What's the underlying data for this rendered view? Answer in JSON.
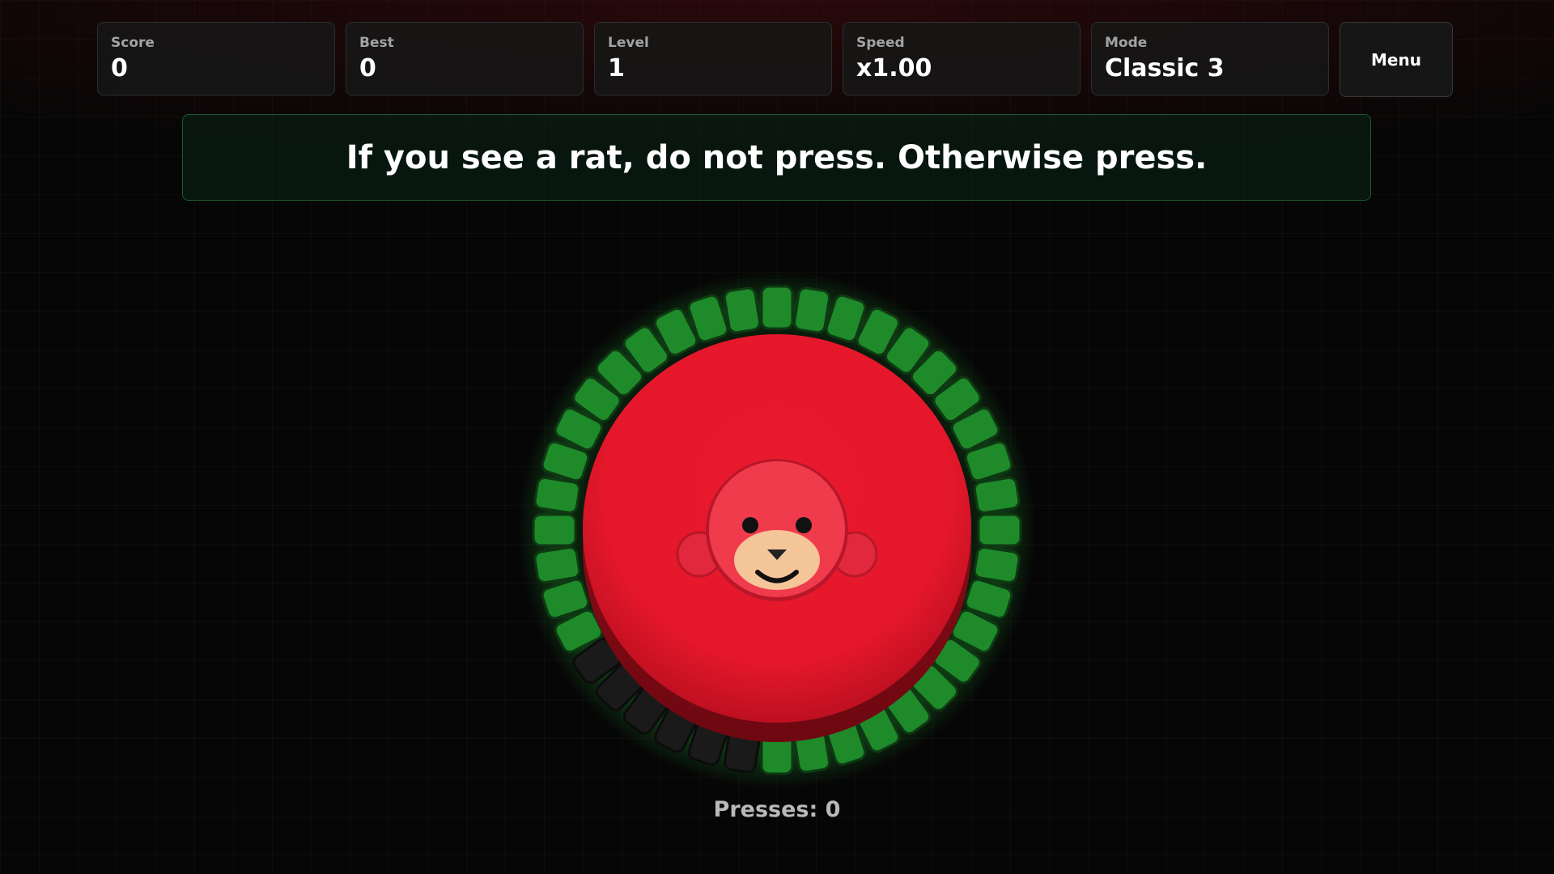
{
  "hud": {
    "stats": [
      {
        "label": "Score",
        "value": "0"
      },
      {
        "label": "Best",
        "value": "0"
      },
      {
        "label": "Level",
        "value": "1"
      },
      {
        "label": "Speed",
        "value": "x1.00"
      },
      {
        "label": "Mode",
        "value": "Classic 3"
      }
    ],
    "menu_label": "Menu"
  },
  "instruction": "If you see a rat, do not press. Otherwise press.",
  "timer_ring": {
    "segments_total": 40,
    "segments_remaining": 34,
    "color": "#1f8a2a",
    "empty_color": "#1a1a1a"
  },
  "button": {
    "color": "#e8182c",
    "character_icon": "monkey-face-icon"
  },
  "presses": {
    "text": "Presses: 0"
  }
}
